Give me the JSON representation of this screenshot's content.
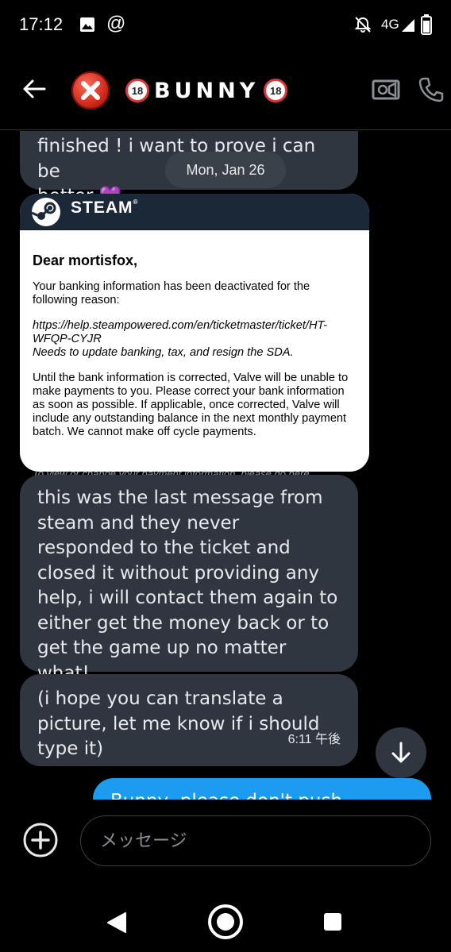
{
  "status_bar": {
    "time": "17:12",
    "at_symbol": "@",
    "network": "4G",
    "icons": [
      "image-icon",
      "bell-off-icon",
      "signal-icon",
      "battery-icon"
    ]
  },
  "header": {
    "title": "BUNNY",
    "badge": "18",
    "avatar_icon": "red-x-icon",
    "actions": [
      "video-call-icon",
      "phone-icon"
    ]
  },
  "messages": {
    "partial_top": {
      "line1": "finished ! i want to prove i can be",
      "line2": "better",
      "emoji": "💜"
    },
    "date_separator": "Mon, Jan 26",
    "steam_image": {
      "brand": "STEAM",
      "greeting": "Dear mortisfox,",
      "intro": "Your banking information has been deactivated for the following reason:",
      "link": "https://help.steampowered.com/en/ticketmaster/ticket/HT-WFQP-CYJR",
      "reason": "Needs to update banking, tax, and resign the SDA.",
      "paragraph": "Until the bank information is corrected, Valve will be unable to make payments to you. Please correct your bank information as soon as possible. If applicable, once corrected, Valve will include any outstanding balance in the next monthly payment batch. We cannot make off cycle payments.",
      "cutoff_line": "To view or change your payment information, please go here"
    },
    "incoming_2": "this was the last message from steam and they never responded to the ticket and closed it without providing any help, i will contact them again to either get the money back or to get the game up no matter what!",
    "incoming_3": "(i hope you can translate a picture, let me know if i should type it)",
    "incoming_3_time": "6:11 午後",
    "outgoing_partial": "Bunny, please don't push yourself"
  },
  "composer": {
    "placeholder": "メッセージ"
  },
  "colors": {
    "bubble_in": "#2f3640",
    "bubble_out": "#1d9bf0",
    "background": "#000000",
    "steam_header": "#1b2838"
  }
}
